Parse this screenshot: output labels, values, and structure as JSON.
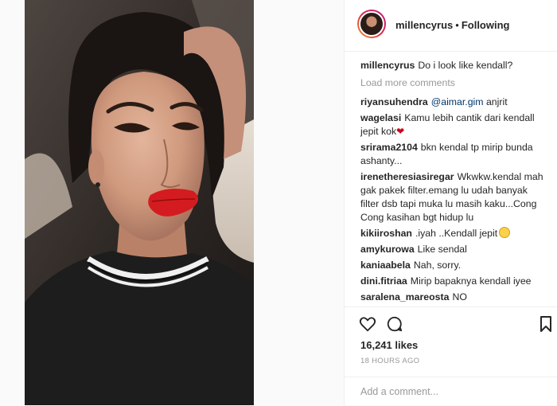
{
  "post": {
    "username": "millencyrus",
    "separator": "•",
    "follow_status": "Following",
    "caption_user": "millencyrus",
    "caption": "Do i look like kendall?",
    "load_more": "Load more comments",
    "likes": "16,241 likes",
    "time": "18 HOURS AGO",
    "comment_placeholder": "Add a comment..."
  },
  "comments": [
    {
      "user": "riyansuhendra",
      "mention": "@aimar.gim",
      "text": "anjrit"
    },
    {
      "user": "wagelasi",
      "text": "Kamu lebih cantik dari kendall",
      "text2": "jepit kok"
    },
    {
      "user": "srirama2104",
      "text": "bkn kendal tp mirip bunda",
      "text2": "ashanty..."
    },
    {
      "user": "irenetheresiasiregar",
      "text": "Wkwkw.kendal mah",
      "text2": "gak pakek filter.emang lu udah banyak",
      "text3": "filter dsb tapi muka lu masih kaku...Cong",
      "text4": "Cong kasihan bgt hidup lu"
    },
    {
      "user": "kikiiroshan",
      "text": ".iyah ..Kendall jepit"
    },
    {
      "user": "amykurowa",
      "text": "Like sendal"
    },
    {
      "user": "kaniaabela",
      "text": "Nah, sorry."
    },
    {
      "user": "dini.fitriaa",
      "text": "Mirip bapaknya kendall iyee"
    },
    {
      "user": "saralena_mareosta",
      "text": "NO"
    }
  ],
  "icons": {
    "heart": "heart-icon",
    "comment": "comment-icon",
    "save": "bookmark-icon"
  },
  "colors": {
    "lips": "#d41c20",
    "mention": "#003569",
    "muted": "#999999"
  }
}
